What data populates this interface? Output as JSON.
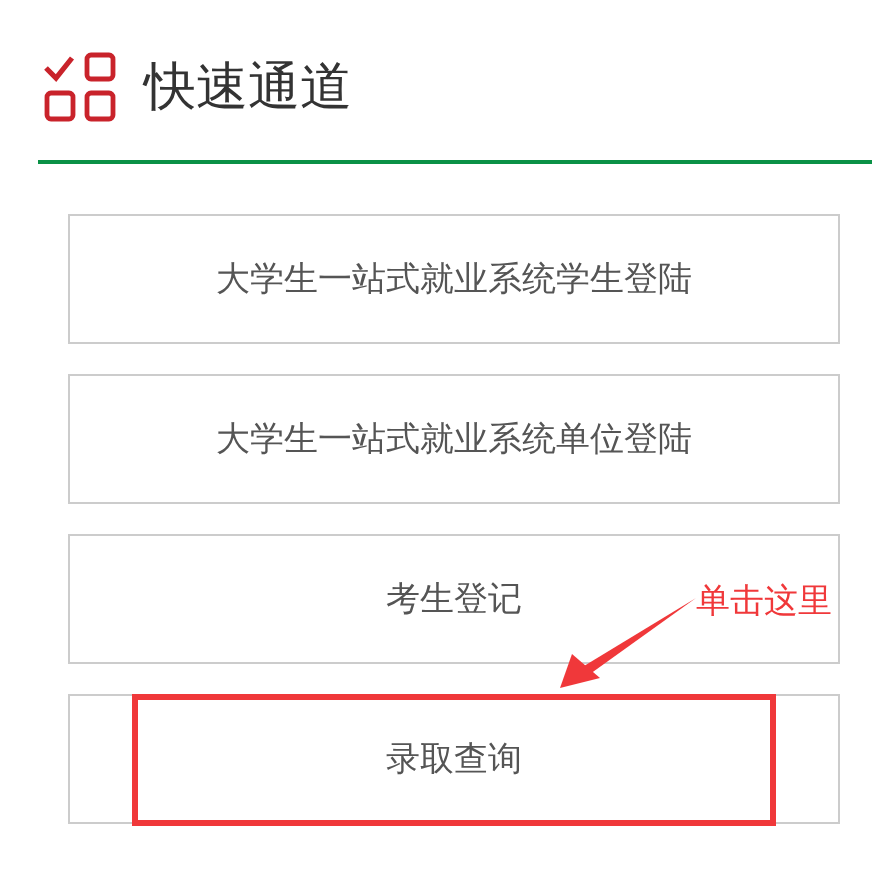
{
  "section": {
    "title": "快速通道"
  },
  "links": [
    {
      "label": "大学生一站式就业系统学生登陆",
      "highlighted": false
    },
    {
      "label": "大学生一站式就业系统单位登陆",
      "highlighted": false
    },
    {
      "label": "考生登记",
      "highlighted": false
    },
    {
      "label": "录取查询",
      "highlighted": true
    }
  ],
  "annotation": {
    "text": "单击这里"
  }
}
